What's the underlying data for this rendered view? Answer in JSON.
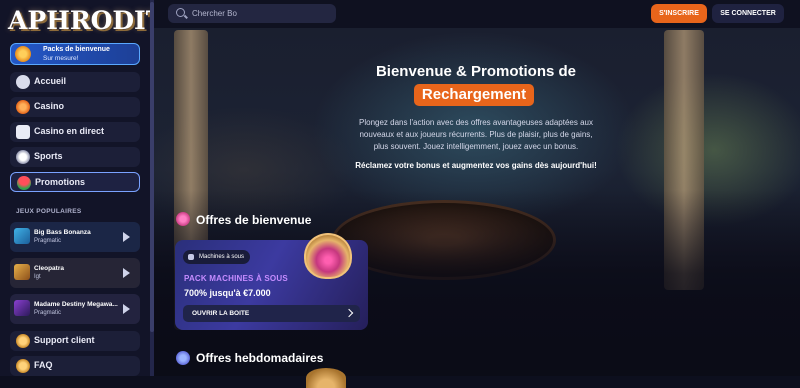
{
  "brand": {
    "logo_text": "APHRODITE"
  },
  "header": {
    "search_placeholder": "Chercher Bo",
    "signup_label": "S'INSCRIRE",
    "login_label": "SE CONNECTER"
  },
  "sidebar": {
    "promo_pill": {
      "title": "Packs de bienvenue",
      "subtitle": "Sur mesure!"
    },
    "nav": [
      {
        "label": "Accueil",
        "icon": "home-icon"
      },
      {
        "label": "Casino",
        "icon": "casino-chip-icon"
      },
      {
        "label": "Casino en direct",
        "icon": "dice-icon"
      },
      {
        "label": "Sports",
        "icon": "soccer-ball-icon"
      },
      {
        "label": "Promotions",
        "icon": "watermelon-icon",
        "active": true
      }
    ],
    "popular_title": "JEUX POPULAIRES",
    "games": [
      {
        "name": "Big Bass Bonanza",
        "provider": "Pragmatic"
      },
      {
        "name": "Cleopatra",
        "provider": "Igt"
      },
      {
        "name": "Madame Destiny Megawa...",
        "provider": "Pragmatic"
      }
    ],
    "footer_nav": [
      {
        "label": "Support client",
        "icon": "support-icon"
      },
      {
        "label": "FAQ",
        "icon": "faq-icon"
      }
    ]
  },
  "hero": {
    "title": "Bienvenue & Promotions de",
    "highlight": "Rechargement",
    "description": "Plongez dans l'action avec des offres avantageuses adaptées aux nouveaux et aux joueurs récurrents. Plus de plaisir, plus de gains, plus souvent. Jouez intelligemment, jouez avec un bonus.",
    "cta": "Réclamez votre bonus et augmentez vos gains dès aujourd'hui!"
  },
  "sections": {
    "welcome_title": "Offres de bienvenue",
    "weekly_title": "Offres hebdomadaires"
  },
  "offer_card": {
    "tag": "Machines à sous",
    "name": "PACK MACHINES À SOUS",
    "amount": "700% jusqu'à €7.000",
    "button": "OUVRIR LA BOITE"
  },
  "colors": {
    "accent": "#e8651b",
    "active_border": "#7aa2ff",
    "card_name": "#c58cff"
  }
}
